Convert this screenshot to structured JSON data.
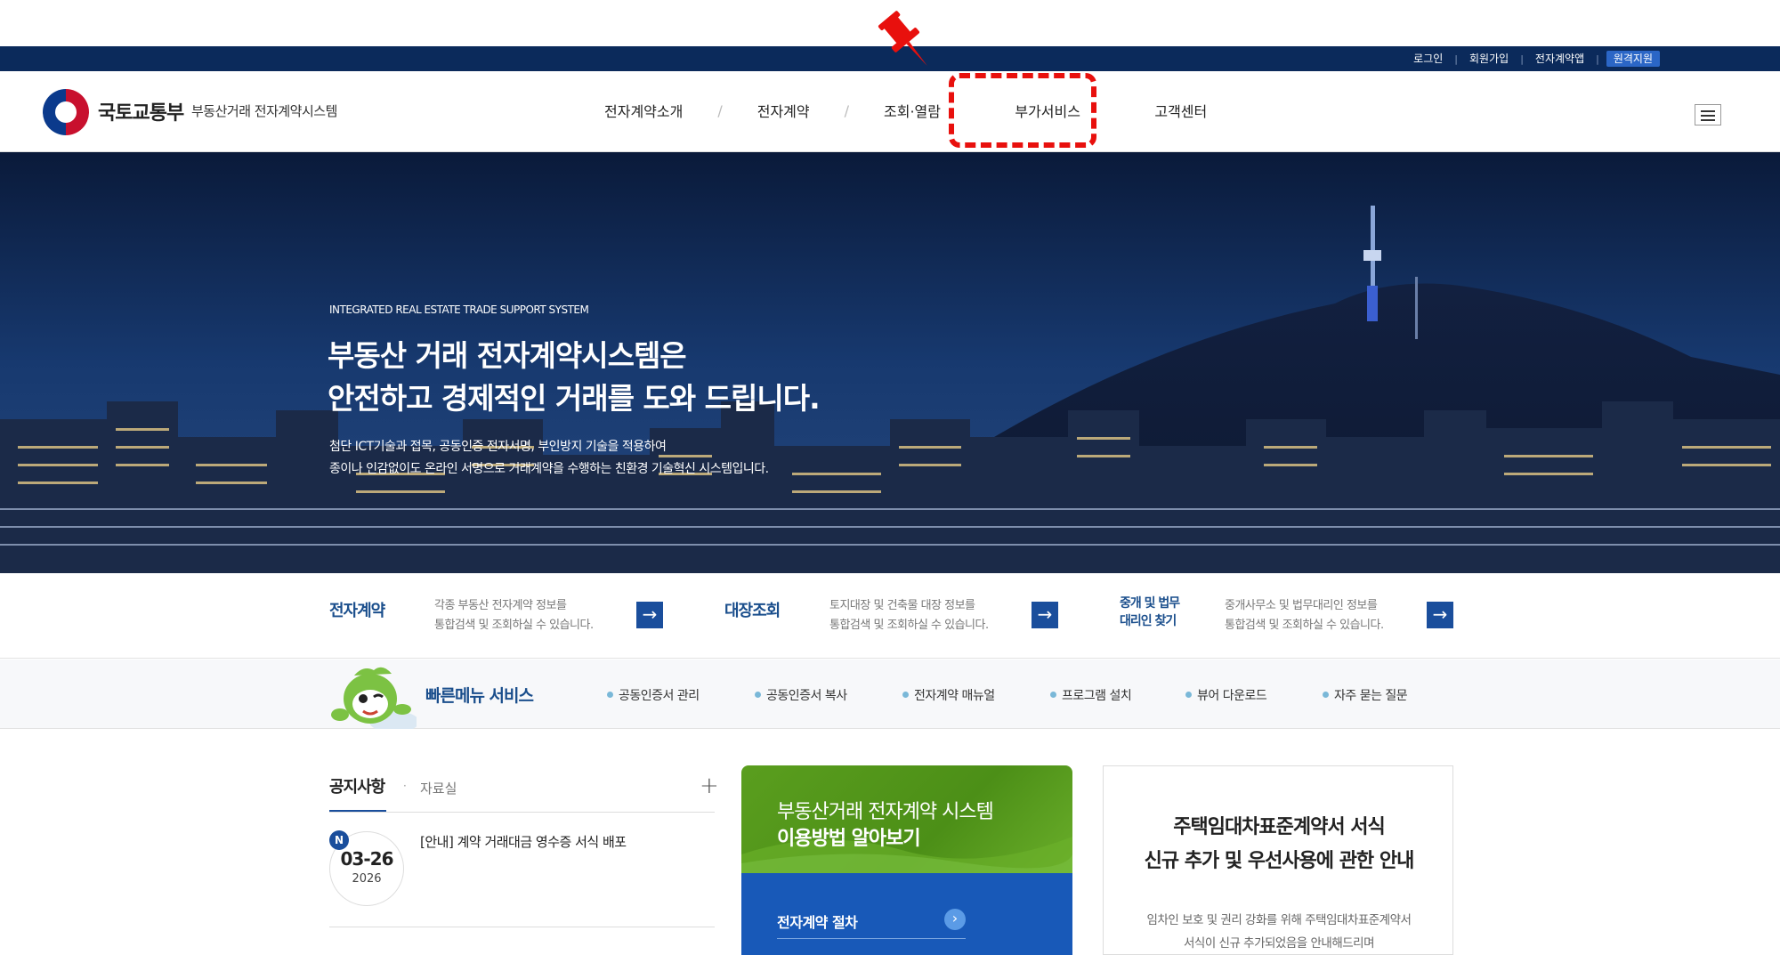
{
  "util": {
    "links": [
      "로그인",
      "회원가입",
      "전자계약앱"
    ],
    "remote": "원격지원"
  },
  "header": {
    "ministry": "국토교통부",
    "system_name": "부동산거래 전자계약시스템",
    "nav": [
      "전자계약소개",
      "전자계약",
      "조회·열람",
      "부가서비스",
      "고객센터"
    ],
    "separator": "/"
  },
  "hero": {
    "eyebrow": "INTEGRATED REAL ESTATE TRADE SUPPORT SYSTEM",
    "title_line1": "부동산 거래 전자계약시스템은",
    "title_line2": "안전하고 경제적인 거래를 도와 드립니다.",
    "desc_line1": "첨단 ICT기술과 접목, 공동인증 전자서명, 부인방지 기술을 적용하여",
    "desc_line2": "종이나 인감없이도 온라인 서명으로 거래계약을 수행하는 친환경 기술혁신 시스템입니다."
  },
  "services": [
    {
      "title": "전자계약",
      "desc1": "각종 부동산 전자계약 정보를",
      "desc2": "통합검색 및 조회하실 수 있습니다."
    },
    {
      "title": "대장조회",
      "desc1": "토지대장 및 건축물 대장 정보를",
      "desc2": "통합검색 및 조회하실 수 있습니다."
    },
    {
      "title_line1": "중개 및 법무",
      "title_line2": "대리인 찾기",
      "desc1": "중개사무소 및 법무대리인 정보를",
      "desc2": "통합검색 및 조회하실 수 있습니다."
    }
  ],
  "quick_menu": {
    "title": "빠른메뉴 서비스",
    "items": [
      "공동인증서 관리",
      "공동인증서 복사",
      "전자계약 매뉴얼",
      "프로그램 설치",
      "뷰어 다운로드",
      "자주 묻는 질문"
    ]
  },
  "notice": {
    "tab_active": "공지사항",
    "tab_dot": "·",
    "tab_other": "자료실",
    "plus": "+",
    "badge": "N",
    "date_md": "03-26",
    "date_year": "2026",
    "title": "[안내] 계약 거래대금 영수증 서식 배포"
  },
  "guide": {
    "line1": "부동산거래 전자계약 시스템",
    "line2": "이용방법 알아보기",
    "item": "전자계약 절차"
  },
  "info": {
    "title_line1": "주택임대차표준계약서 서식",
    "title_line2": "신규 추가 및 우선사용에 관한 안내",
    "desc_line1": "임차인 보호 및 권리 강화를 위해 주택임대차표준계약서",
    "desc_line2": "서식이 신규 추가되었음을 안내해드리며"
  },
  "colors": {
    "navy": "#0b2a5b",
    "accent_blue": "#1a4e9c",
    "highlight_red": "#e8100d",
    "guide_green": "#5a9e1e"
  }
}
